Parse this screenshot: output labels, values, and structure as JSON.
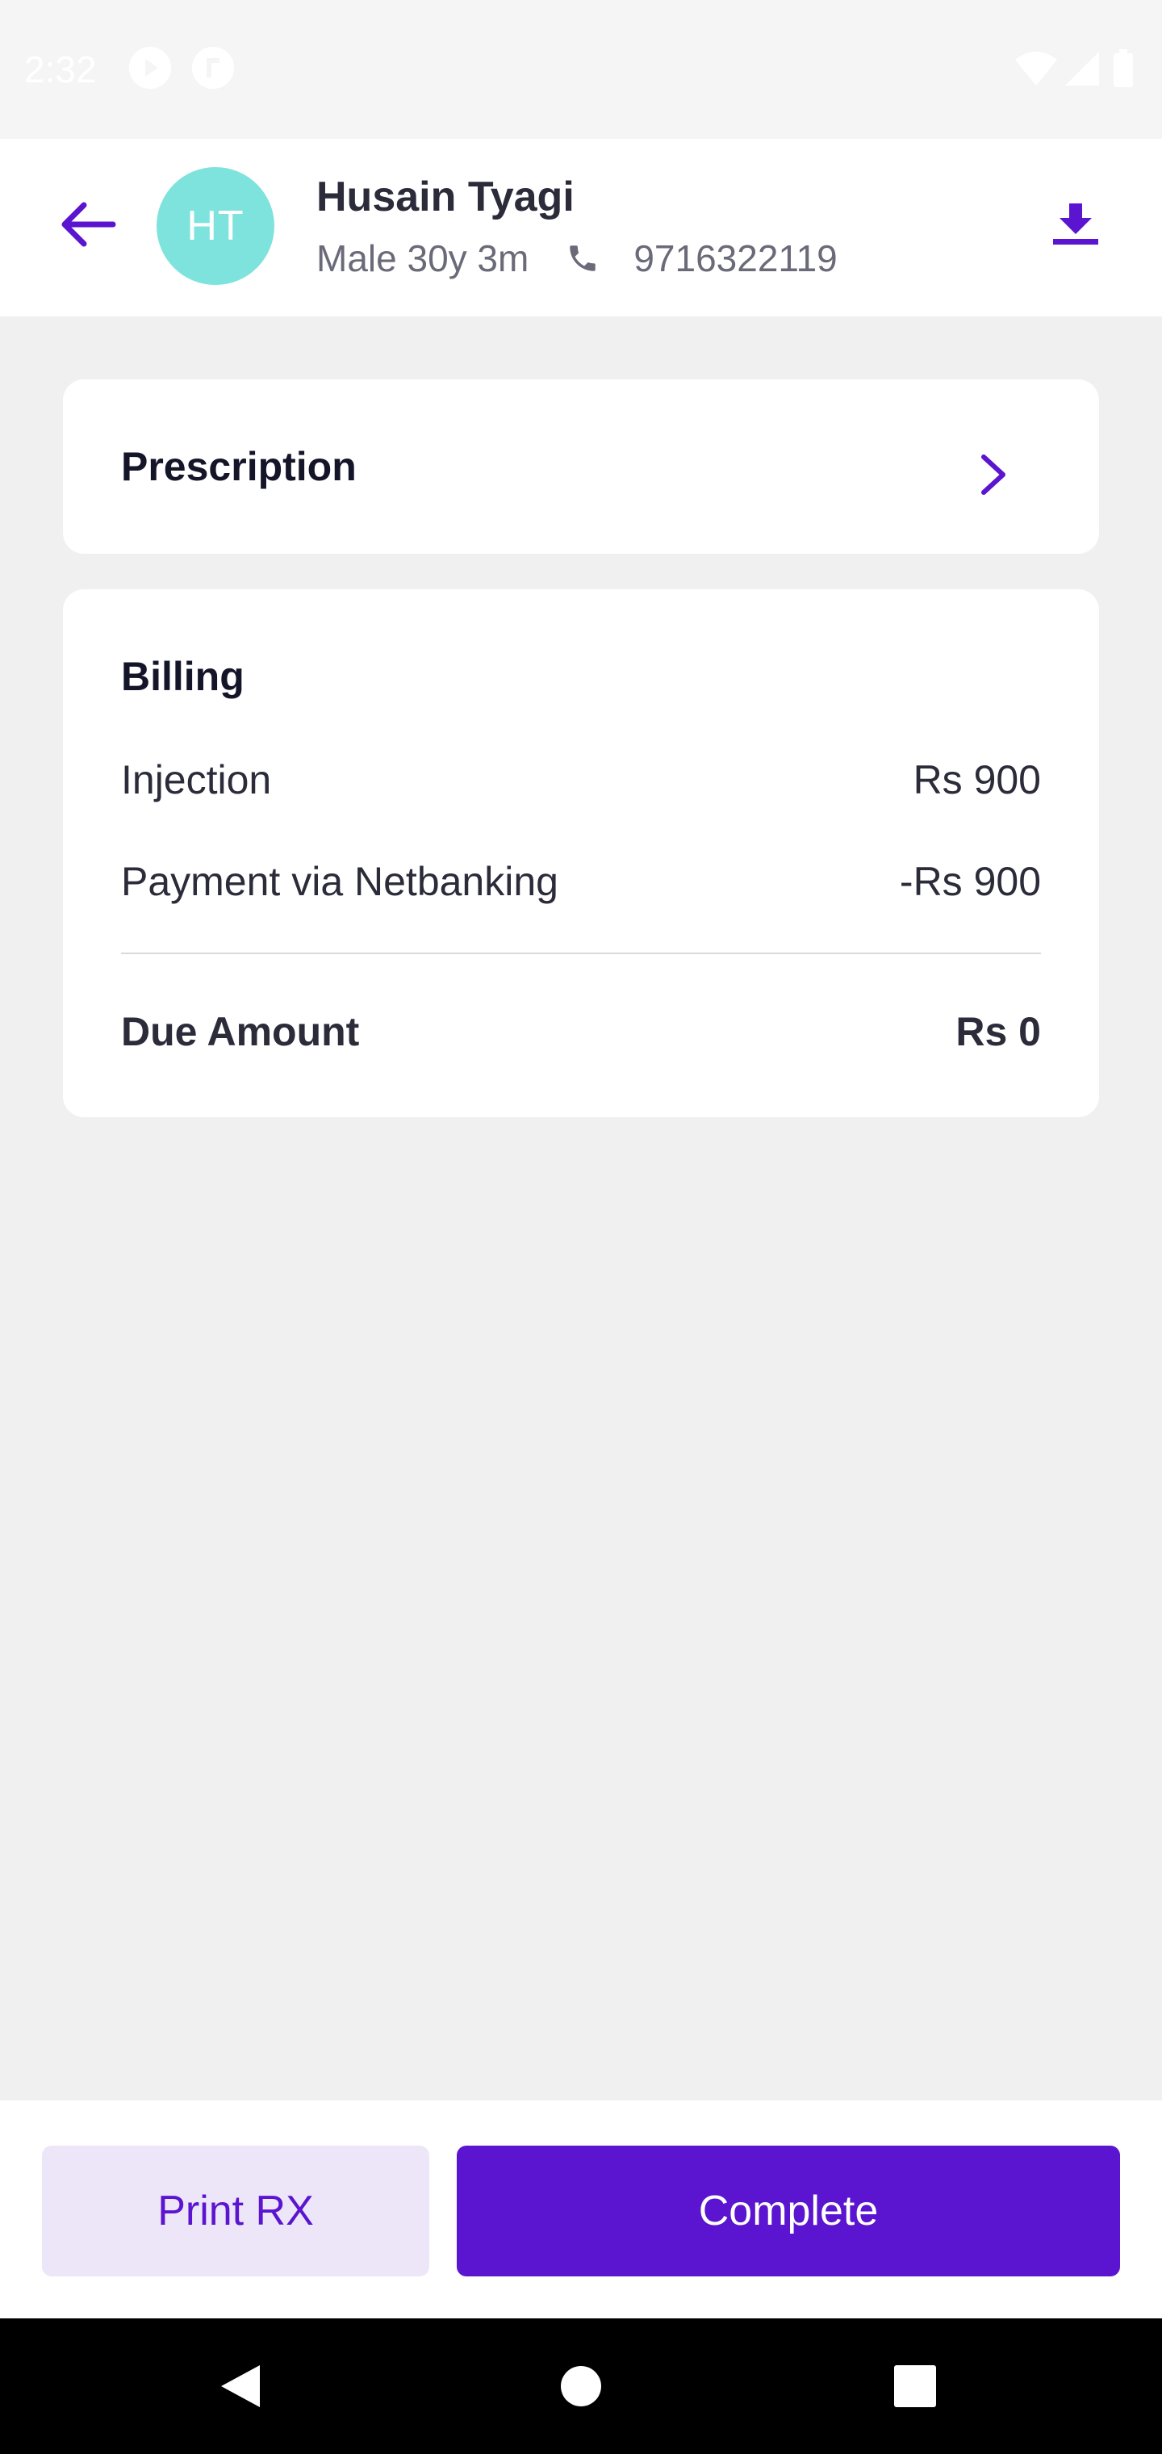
{
  "status_bar": {
    "time": "2:32",
    "icons": [
      "media-play-icon",
      "sync-icon",
      "wifi-icon",
      "signal-icon",
      "battery-icon"
    ]
  },
  "header": {
    "back_icon": "arrow-left-icon",
    "avatar_initials": "HT",
    "patient_name": "Husain Tyagi",
    "patient_info": "Male 30y 3m",
    "phone_icon": "phone-icon",
    "phone": "9716322119",
    "download_icon": "download-icon"
  },
  "prescription": {
    "title": "Prescription",
    "chevron_icon": "chevron-right-icon"
  },
  "billing": {
    "title": "Billing",
    "items": [
      {
        "label": "Injection",
        "amount": "Rs 900"
      },
      {
        "label": "Payment via Netbanking",
        "amount": "-Rs 900"
      }
    ],
    "due_label": "Due Amount",
    "due_amount": "Rs 0"
  },
  "actions": {
    "print_label": "Print RX",
    "complete_label": "Complete"
  },
  "nav": {
    "icons": [
      "back-triangle-icon",
      "home-circle-icon",
      "recents-square-icon"
    ]
  },
  "colors": {
    "accent": "#5b14cf",
    "accent_light": "#ede6f8",
    "avatar": "#7fe3dd",
    "background": "#f0f0f0"
  }
}
